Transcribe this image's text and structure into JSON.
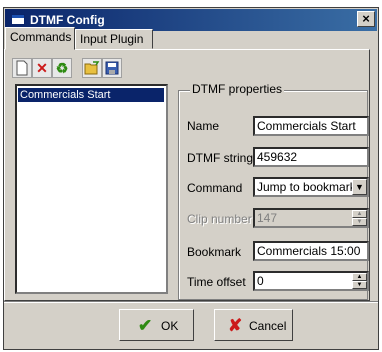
{
  "window": {
    "title": "DTMF Config",
    "close_glyph": "×"
  },
  "tabs": [
    {
      "label": "Commands",
      "active": true
    },
    {
      "label": "Input Plugin",
      "active": false
    }
  ],
  "toolbar": {
    "icons": [
      "new-icon",
      "delete-icon",
      "refresh-icon",
      "open-icon",
      "save-icon"
    ]
  },
  "list": {
    "items": [
      "Commercials Start"
    ],
    "selected_index": 0
  },
  "properties": {
    "group_title": "DTMF properties",
    "name": {
      "label": "Name",
      "value": "Commercials Start"
    },
    "dtmf": {
      "label": "DTMF string",
      "value": "459632"
    },
    "command": {
      "label": "Command",
      "value": "Jump to bookmark"
    },
    "clip": {
      "label": "Clip number",
      "value": "147",
      "disabled": true
    },
    "bookmark": {
      "label": "Bookmark",
      "value": "Commercials 15:00"
    },
    "offset": {
      "label": "Time offset",
      "value": "0"
    }
  },
  "buttons": {
    "ok": "OK",
    "cancel": "Cancel"
  },
  "colors": {
    "title_start": "#0a246a",
    "title_end": "#3a6ea5",
    "selection": "#0a246a",
    "ok_check": "#2e8b12",
    "cancel_x": "#cc1a1a"
  }
}
